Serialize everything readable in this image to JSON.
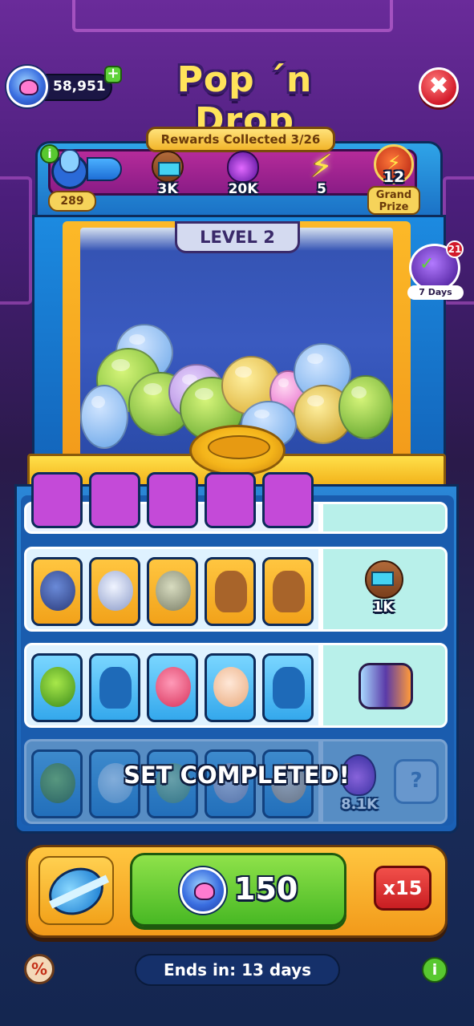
{
  "header": {
    "currency_amount": "58,951",
    "currency_plus": "+",
    "title": "Pop ´n Drop",
    "close_symbol": "✖"
  },
  "rewards": {
    "header": "Rewards Collected 3/26",
    "level_count": "289",
    "info_symbol": "i",
    "items": [
      {
        "icon": "boost-icon",
        "amount": "3K"
      },
      {
        "icon": "potion-icon",
        "amount": "20K"
      },
      {
        "icon": "lightning-icon",
        "amount": "5"
      }
    ],
    "grand_prize": {
      "icon": "lightning-badge-icon",
      "amount": "12",
      "label": "Grand Prize"
    }
  },
  "machine": {
    "level_label": "LEVEL 2"
  },
  "daily_tasks": {
    "count": "21",
    "label": "7 Days"
  },
  "sets": {
    "orange_prize_amount": "1K",
    "done_prize_amount": "8.1K",
    "set_completed_label": "SET COMPLETED!"
  },
  "action_bar": {
    "play_cost": "150",
    "multiplier": "x15"
  },
  "footer": {
    "discount_symbol": "%",
    "timer": "Ends in: 13 days",
    "info_symbol": "i"
  },
  "colors": {
    "accent_yellow": "#ffe35a",
    "play_green": "#48b824",
    "close_red": "#d21a2a",
    "panel_blue": "#1a5fb4"
  }
}
